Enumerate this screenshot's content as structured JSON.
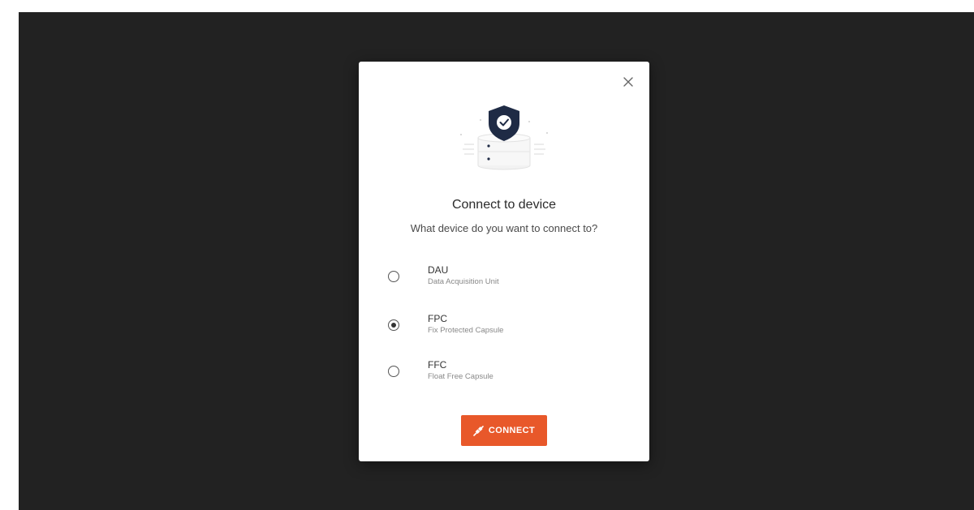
{
  "dialog": {
    "title": "Connect to device",
    "subtitle": "What device do you want to connect to?",
    "close_icon": "close-icon",
    "illustration_icon": "shield-check-icon",
    "options": [
      {
        "name": "DAU",
        "description": "Data Acquisition Unit",
        "selected": false
      },
      {
        "name": "FPC",
        "description": "Fix Protected Capsule",
        "selected": true
      },
      {
        "name": "FFC",
        "description": "Float Free Capsule",
        "selected": false
      }
    ],
    "connect_button": {
      "label": "CONNECT",
      "icon": "plug-connect-icon"
    }
  },
  "colors": {
    "backdrop": "#222222",
    "dialog_bg": "#ffffff",
    "accent": "#e8582a",
    "shield": "#1f2b45"
  }
}
